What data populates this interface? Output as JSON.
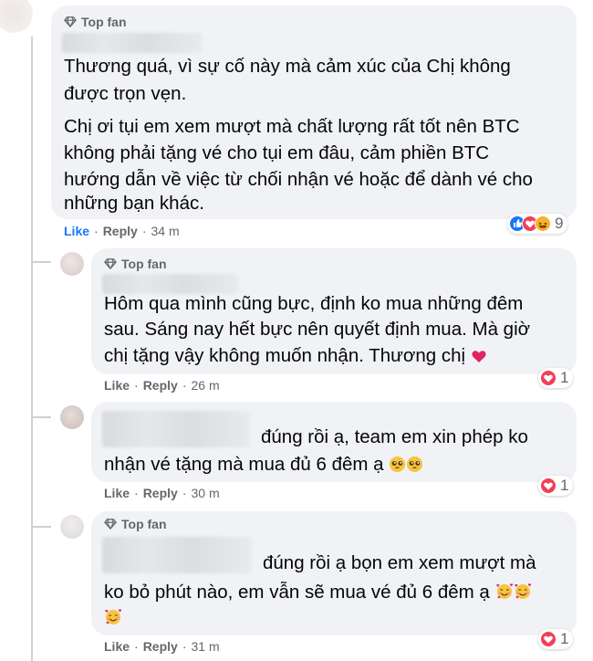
{
  "colors": {
    "bubble": "#f0f2f5",
    "meta": "#65676b",
    "like_active": "#1877f2",
    "heart": "#f33e58",
    "like_react": "#1877f2",
    "haha": "#f7b125"
  },
  "comments": [
    {
      "badge": "Top fan",
      "lines": [
        "Thương quá, vì sự cố này mà cảm xúc của Chị không",
        "được trọn vẹn."
      ],
      "lines2": [
        "Chị ơi tụi em xem mượt mà chất lượng rất tốt nên BTC",
        "không phải tặng vé cho tụi em đâu, cảm phiền BTC",
        "hướng dẫn về việc từ chối nhận vé hoặc để dành vé cho",
        "những bạn khác."
      ],
      "like": "Like",
      "reply": "Reply",
      "time": "34 m",
      "reactions": [
        "like",
        "heart",
        "haha"
      ],
      "reaction_count": "9"
    },
    {
      "badge": "Top fan",
      "lines": [
        "Hôm qua mình cũng bực, định ko mua những đêm",
        "sau. Sáng nay hết bực nên quyết định mua. Mà giờ",
        "chị tặng vậy không muốn nhận. Thương chị"
      ],
      "like": "Like",
      "reply": "Reply",
      "time": "26 m",
      "reactions": [
        "heart"
      ],
      "reaction_count": "1"
    },
    {
      "lines": [
        "đúng rồi ạ, team em xin phép ko",
        "nhận vé tặng mà mua đủ 6 đêm ạ"
      ],
      "like": "Like",
      "reply": "Reply",
      "time": "30 m",
      "reactions": [
        "heart"
      ],
      "reaction_count": "1"
    },
    {
      "badge": "Top fan",
      "lines": [
        "đúng rồi ạ bọn em xem mượt mà",
        "ko bỏ phút nào, em vẫn sẽ mua vé đủ 6 đêm ạ"
      ],
      "like": "Like",
      "reply": "Reply",
      "time": "31 m",
      "reactions": [
        "heart"
      ],
      "reaction_count": "1"
    }
  ]
}
